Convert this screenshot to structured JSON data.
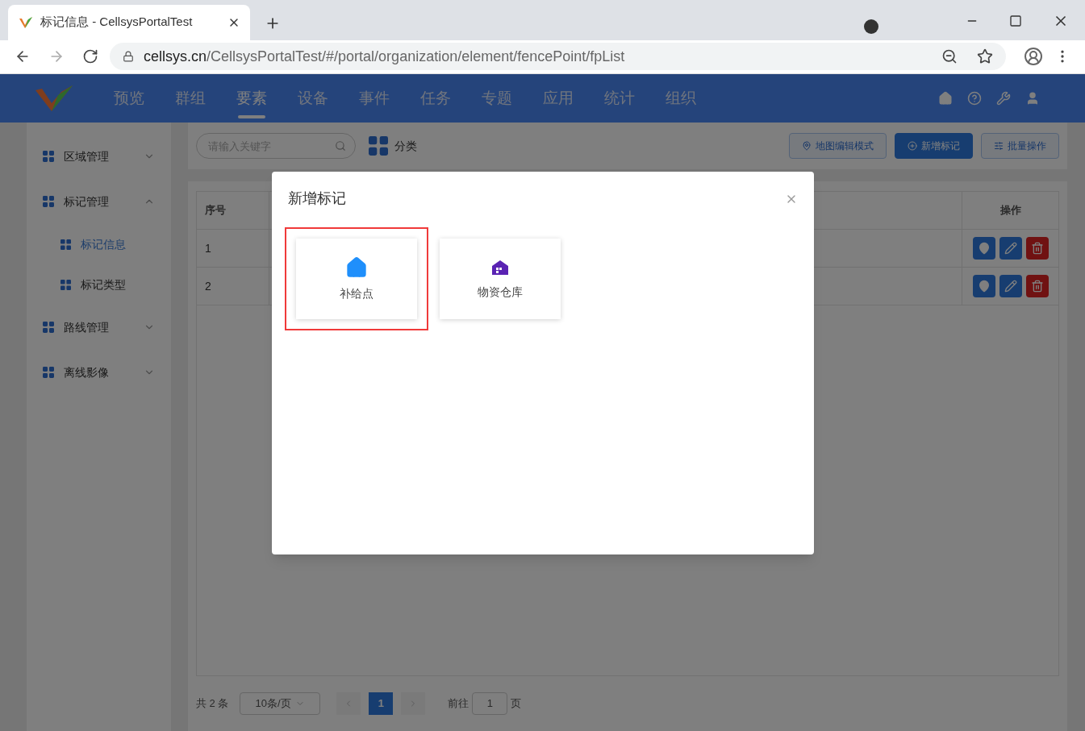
{
  "browser": {
    "tab_title": "标记信息 - CellsysPortalTest",
    "url_host": "cellsys.cn",
    "url_path": "/CellsysPortalTest/#/portal/organization/element/fencePoint/fpList"
  },
  "nav": {
    "items": [
      {
        "label": "预览",
        "selected": false
      },
      {
        "label": "群组",
        "selected": false
      },
      {
        "label": "要素",
        "selected": true
      },
      {
        "label": "设备",
        "selected": false
      },
      {
        "label": "事件",
        "selected": false
      },
      {
        "label": "任务",
        "selected": false
      },
      {
        "label": "专题",
        "selected": false
      },
      {
        "label": "应用",
        "selected": false
      },
      {
        "label": "统计",
        "selected": false
      },
      {
        "label": "组织",
        "selected": false
      }
    ]
  },
  "sidebar": {
    "groups": [
      {
        "label": "区域管理",
        "expanded": false
      },
      {
        "label": "标记管理",
        "expanded": true,
        "children": [
          {
            "label": "标记信息",
            "selected": true
          },
          {
            "label": "标记类型",
            "selected": false
          }
        ]
      },
      {
        "label": "路线管理",
        "expanded": false
      },
      {
        "label": "离线影像",
        "expanded": false
      }
    ]
  },
  "toolbar": {
    "search": {
      "placeholder": "请输入关键字"
    },
    "category_label": "分类",
    "buttons": [
      {
        "label": "地图编辑模式",
        "kind": "map"
      },
      {
        "label": "新增标记",
        "kind": "add"
      },
      {
        "label": "批量操作",
        "kind": "batch"
      }
    ]
  },
  "table": {
    "columns": [
      "序号",
      "操作"
    ],
    "rows": [
      {
        "index": "1"
      },
      {
        "index": "2"
      }
    ]
  },
  "pagination": {
    "total": "共 2 条",
    "page_size": "10条/页",
    "pages": [
      {
        "label": "1",
        "selected": true
      }
    ],
    "goto_label": "前往",
    "goto_value": "1",
    "goto_suffix": "页"
  },
  "dialog": {
    "title": "新增标记",
    "options": [
      {
        "label": "补给点",
        "kind": "house",
        "selected": true
      },
      {
        "label": "物资仓库",
        "kind": "warehouse",
        "selected": false
      }
    ]
  }
}
